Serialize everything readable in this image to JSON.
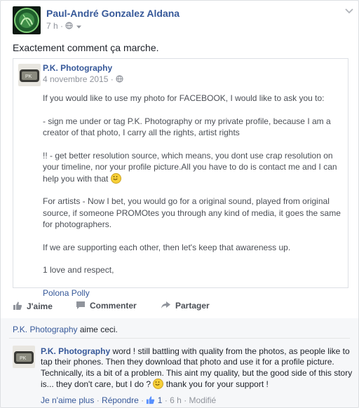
{
  "post": {
    "author": "Paul-André Gonzalez Aldana",
    "time": "7 h",
    "status_text": "Exactement comment ça marche."
  },
  "shared": {
    "author": "P.K. Photography",
    "date": "4 novembre 2015",
    "paragraphs": [
      "If you would like to use my photo for FACEBOOK, I would like to ask you to:",
      "- sign me under or tag P.K. Photography or my private profile, because I am a creator of that photo, I carry all the rights, artist rights",
      "!! - get better resolution source, which means, you dont use crap resolution on your timeline, nor your profile picture.All you have to do is contact me and I can help you with that",
      "For artists - Now I bet, you would go for a original sound, played from original source, if someone PROMOtes you through any kind of media, it goes the same for photographers.",
      "If we are supporting each other, then let's keep that awareness up.",
      "1 love and respect,"
    ],
    "signature": "Polona Polly"
  },
  "actions": {
    "like": "J'aime",
    "comment": "Commenter",
    "share": "Partager"
  },
  "likes_line": {
    "page": "P.K. Photography",
    "suffix": " aime ceci."
  },
  "comment": {
    "author": "P.K. Photography",
    "text": " word ! still battling with quality from the photos, as people like to tap their phones. Then they download that photo and use it for a profile picture. Technically, its a bit of a problem. This aint my quality, but the good side of this story is... they don't care, but I do ?",
    "text_end": " thank you for your support !",
    "unlike": "Je n'aime plus",
    "reply": "Répondre",
    "like_count": "1",
    "time": "6 h",
    "edited": "Modifié"
  },
  "colors": {
    "link": "#365899",
    "meta": "#90949c",
    "text": "#1d2129",
    "background": "#e9ebee"
  },
  "icons": [
    "globe-icon",
    "chevron-down-icon",
    "like-icon",
    "comment-icon",
    "share-icon",
    "smiley-icon",
    "thumbs-up-icon"
  ]
}
